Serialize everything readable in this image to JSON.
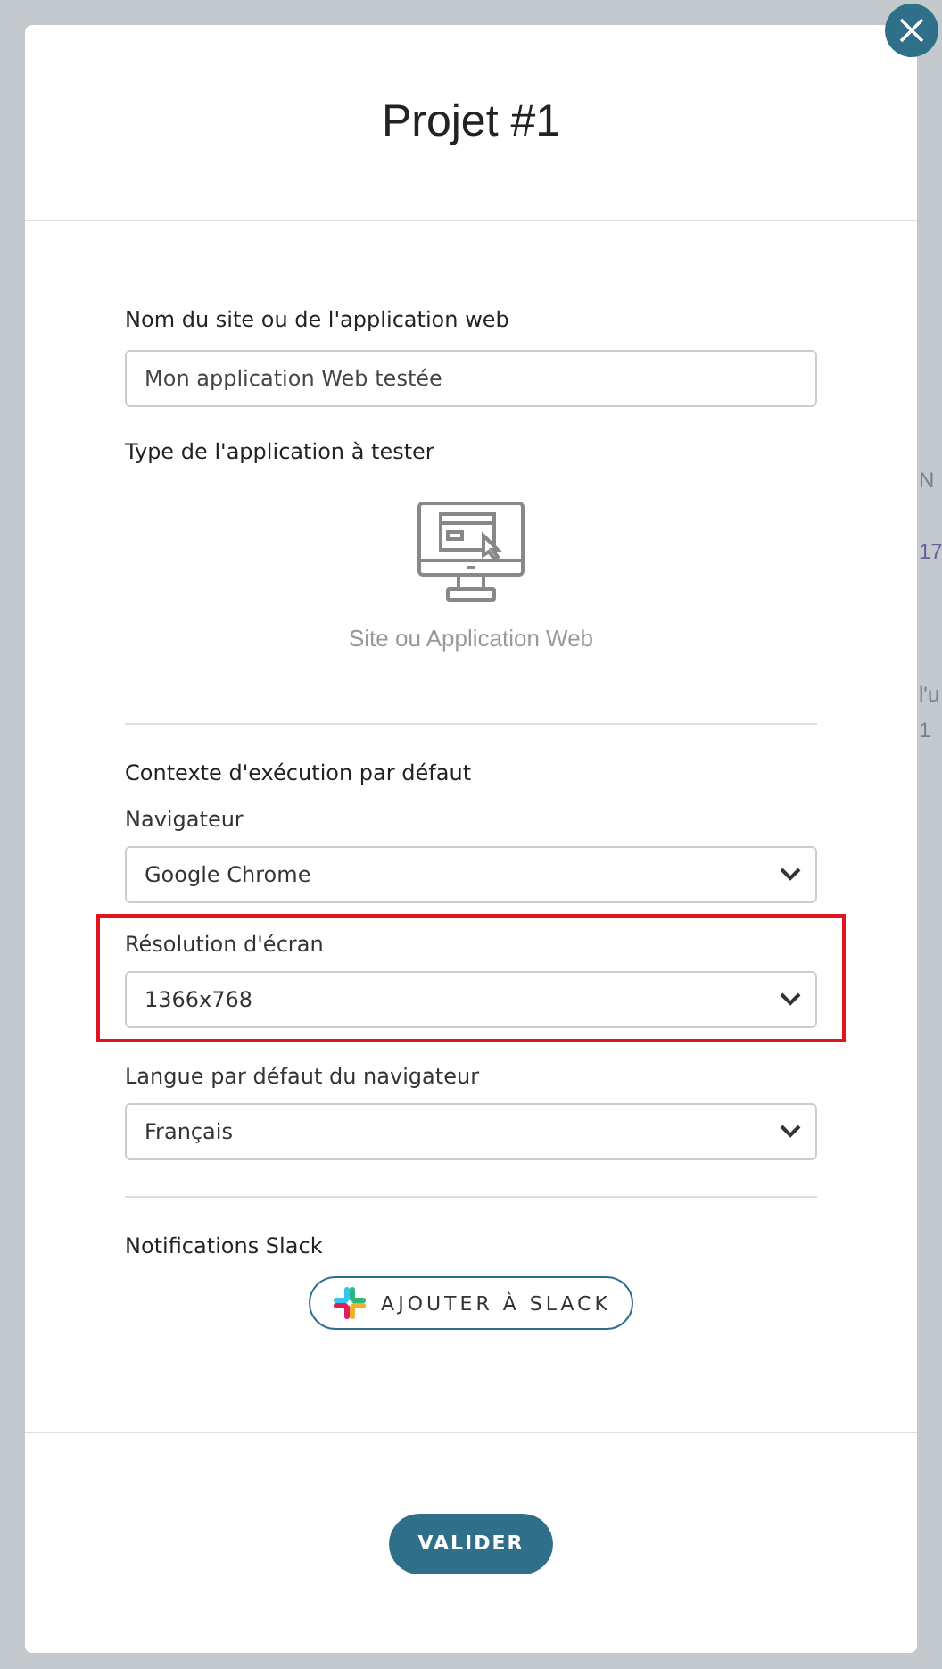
{
  "background": {
    "texts": [
      "N",
      "17",
      "l'u",
      "1"
    ]
  },
  "dialog": {
    "title": "Projet #1",
    "name_field": {
      "label": "Nom du site ou de l'application web",
      "value": "Mon application Web testée"
    },
    "app_type": {
      "label": "Type de l'application à tester",
      "option": "Site ou Application Web"
    },
    "context": {
      "heading": "Contexte d'exécution par défaut",
      "fields": [
        {
          "label": "Navigateur",
          "value": "Google Chrome",
          "highlighted": false
        },
        {
          "label": "Résolution d'écran",
          "value": "1366x768",
          "highlighted": true
        },
        {
          "label": "Langue par défaut du navigateur",
          "value": "Français",
          "highlighted": false
        }
      ]
    },
    "slack": {
      "heading": "Notifications Slack",
      "button": "AJOUTER À SLACK"
    },
    "submit": "VALIDER"
  }
}
